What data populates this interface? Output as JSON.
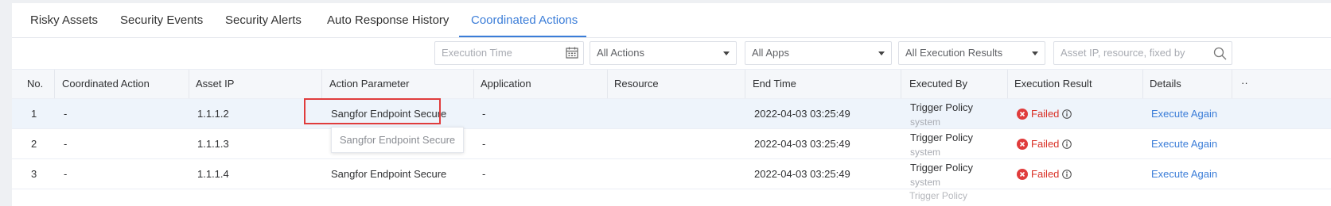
{
  "tabs": [
    {
      "label": "Risky Assets"
    },
    {
      "label": "Security Events"
    },
    {
      "label": "Security Alerts"
    },
    {
      "label": "Auto Response History"
    },
    {
      "label": "Coordinated Actions"
    }
  ],
  "active_tab": "Coordinated Actions",
  "filters": {
    "execution_time_placeholder": "Execution Time",
    "actions_selected": "All Actions",
    "apps_selected": "All Apps",
    "results_selected": "All Execution Results",
    "search_placeholder": "Asset IP, resource, fixed by"
  },
  "table": {
    "columns": [
      "No.",
      "Coordinated Action",
      "Asset IP",
      "Action Parameter",
      "Application",
      "Resource",
      "End Time",
      "Executed By",
      "Execution Result",
      "Details"
    ],
    "more_columns_glyph": "··",
    "rows": [
      {
        "no": "1",
        "action": "-",
        "ip": "1.1.1.2",
        "param": "Sangfor Endpoint Secure",
        "app": "-",
        "resource": "",
        "end_time": "2022-04-03 03:25:49",
        "executed_by": "Trigger Policy",
        "executed_by_sub": "system",
        "result": "Failed",
        "details": "Execute Again"
      },
      {
        "no": "2",
        "action": "-",
        "ip": "1.1.1.3",
        "param": "",
        "app": "-",
        "resource": "",
        "end_time": "2022-04-03 03:25:49",
        "executed_by": "Trigger Policy",
        "executed_by_sub": "system",
        "result": "Failed",
        "details": "Execute Again"
      },
      {
        "no": "3",
        "action": "-",
        "ip": "1.1.1.4",
        "param": "Sangfor Endpoint Secure",
        "app": "-",
        "resource": "",
        "end_time": "2022-04-03 03:25:49",
        "executed_by": "Trigger Policy",
        "executed_by_sub": "system",
        "result": "Failed",
        "details": "Execute Again"
      }
    ],
    "partial_next_row_text": "Trigger Policy"
  },
  "tooltip_text": "Sangfor Endpoint Secure",
  "colors": {
    "accent": "#3b7dd8",
    "failed": "#d93026",
    "highlight_box": "#e03c3c"
  }
}
